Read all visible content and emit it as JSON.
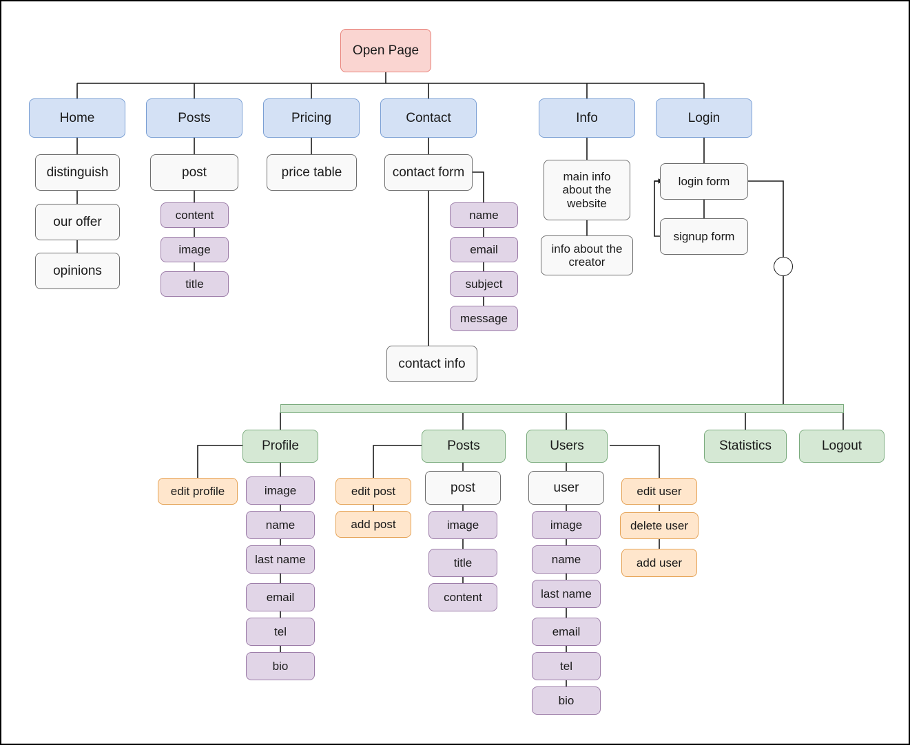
{
  "diagram": {
    "title": "Website Structure Flowchart",
    "colors": {
      "root_fill": "#fad5d1",
      "root_stroke": "#e8827a",
      "nav_fill": "#d4e1f5",
      "nav_stroke": "#7a9fd4",
      "plain_fill": "#f9f9f9",
      "plain_stroke": "#6e6e6e",
      "field_fill": "#e1d5e7",
      "field_stroke": "#9c7ca8",
      "admin_fill": "#d5e8d4",
      "admin_stroke": "#7aab7d",
      "action_fill": "#ffe6cc",
      "action_stroke": "#e5a255",
      "edge": "#1a1a1a",
      "page_border": "#000000",
      "background": "#ffffff"
    }
  },
  "root": {
    "label": "Open Page"
  },
  "nav": {
    "items": [
      {
        "label": "Home"
      },
      {
        "label": "Posts"
      },
      {
        "label": "Pricing"
      },
      {
        "label": "Contact"
      },
      {
        "label": "Info"
      },
      {
        "label": "Login"
      }
    ]
  },
  "home": {
    "children": [
      {
        "label": "distinguish"
      },
      {
        "label": "our offer"
      },
      {
        "label": "opinions"
      }
    ]
  },
  "posts": {
    "entity": {
      "label": "post"
    },
    "fields": [
      {
        "label": "content"
      },
      {
        "label": "image"
      },
      {
        "label": "title"
      }
    ]
  },
  "pricing": {
    "children": [
      {
        "label": "price table"
      }
    ]
  },
  "contact": {
    "form": {
      "label": "contact form"
    },
    "form_fields": [
      {
        "label": "name"
      },
      {
        "label": "email"
      },
      {
        "label": "subject"
      },
      {
        "label": "message"
      }
    ],
    "info": {
      "label": "contact info"
    }
  },
  "info": {
    "children": [
      {
        "label": "main info about the website"
      },
      {
        "label": "info about the creator"
      }
    ]
  },
  "login": {
    "children": [
      {
        "label": "login form"
      },
      {
        "label": "signup form"
      }
    ],
    "connector": {
      "label": "junction-circle"
    }
  },
  "admin": {
    "bar": {
      "label": "admin-panel-bar"
    },
    "sections": [
      {
        "label": "Profile"
      },
      {
        "label": "Posts"
      },
      {
        "label": "Users"
      },
      {
        "label": "Statistics"
      },
      {
        "label": "Logout"
      }
    ],
    "profile": {
      "actions": [
        {
          "label": "edit profile"
        }
      ],
      "fields": [
        {
          "label": "image"
        },
        {
          "label": "name"
        },
        {
          "label": "last name"
        },
        {
          "label": "email"
        },
        {
          "label": "tel"
        },
        {
          "label": "bio"
        }
      ]
    },
    "posts": {
      "actions": [
        {
          "label": "edit post"
        },
        {
          "label": "add post"
        }
      ],
      "entity": {
        "label": "post"
      },
      "fields": [
        {
          "label": "image"
        },
        {
          "label": "title"
        },
        {
          "label": "content"
        }
      ]
    },
    "users": {
      "actions": [
        {
          "label": "edit user"
        },
        {
          "label": "delete user"
        },
        {
          "label": "add user"
        }
      ],
      "entity": {
        "label": "user"
      },
      "fields": [
        {
          "label": "image"
        },
        {
          "label": "name"
        },
        {
          "label": "last name"
        },
        {
          "label": "email"
        },
        {
          "label": "tel"
        },
        {
          "label": "bio"
        }
      ]
    }
  }
}
